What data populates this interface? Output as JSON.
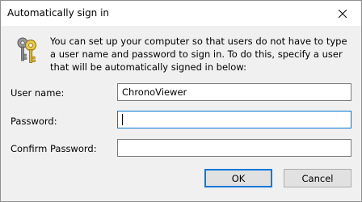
{
  "window": {
    "title": "Automatically sign in",
    "close_icon": "close-icon"
  },
  "intro": {
    "icon": "keys-icon",
    "text": "You can set up your computer so that users do not have to type a user name and password to sign in. To do this, specify a user that will be automatically signed in below:"
  },
  "form": {
    "user_name": {
      "label": "User name:",
      "value": "ChronoViewer"
    },
    "password": {
      "label": "Password:",
      "value": ""
    },
    "confirm_password": {
      "label": "Confirm Password:",
      "value": ""
    }
  },
  "buttons": {
    "ok_label": "OK",
    "cancel_label": "Cancel"
  },
  "colors": {
    "focus_accent": "#0078d7",
    "dialog_background": "#f0f0f0",
    "button_face": "#e1e1e1"
  }
}
